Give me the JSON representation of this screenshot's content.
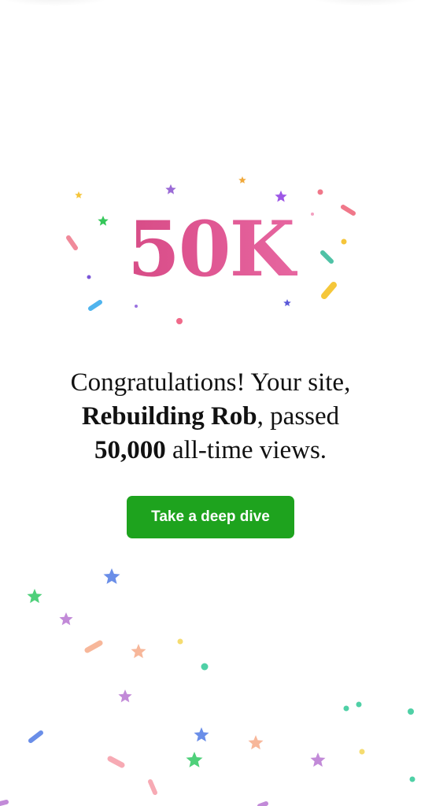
{
  "milestone": {
    "badge_text": "50K"
  },
  "message": {
    "line1": "Congratulations! Your site,",
    "site_name": "Rebuilding Rob",
    "line2_after": ", passed",
    "views_count": "50,000",
    "line3_after": " all-time views."
  },
  "cta": {
    "label": "Take a deep dive",
    "color": "#1ea31e"
  },
  "theme": {
    "milestone_gradient": [
      "#c83d74",
      "#f07bb2"
    ]
  }
}
